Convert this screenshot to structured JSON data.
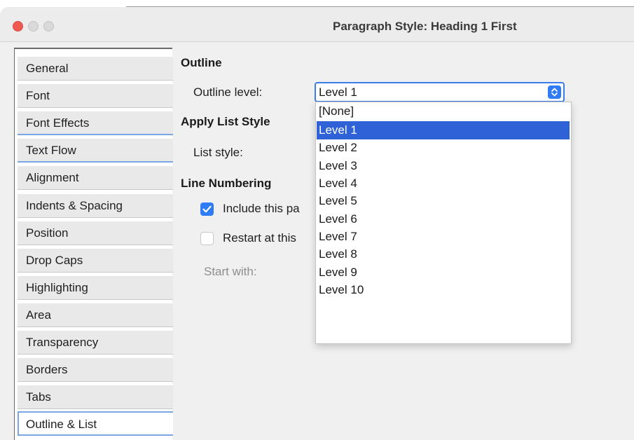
{
  "window": {
    "title": "Paragraph Style: Heading 1 First"
  },
  "sidebar": {
    "tabs": [
      {
        "label": "General"
      },
      {
        "label": "Font"
      },
      {
        "label": "Font Effects"
      },
      {
        "label": "Text Flow"
      },
      {
        "label": "Alignment"
      },
      {
        "label": "Indents & Spacing"
      },
      {
        "label": "Position"
      },
      {
        "label": "Drop Caps"
      },
      {
        "label": "Highlighting"
      },
      {
        "label": "Area"
      },
      {
        "label": "Transparency"
      },
      {
        "label": "Borders"
      },
      {
        "label": "Tabs"
      },
      {
        "label": "Outline & List"
      }
    ],
    "selected": "Outline & List"
  },
  "outline": {
    "heading": "Outline",
    "level_label": "Outline level:",
    "level_value": "Level 1"
  },
  "list_style": {
    "heading": "Apply List Style",
    "label": "List style:"
  },
  "line_numbering": {
    "heading": "Line Numbering",
    "include_label": "Include this pa",
    "include_checked": true,
    "restart_label": "Restart at this",
    "restart_checked": false,
    "start_label": "Start with:"
  },
  "dropdown": {
    "options": [
      {
        "label": "[None]"
      },
      {
        "label": "Level 1"
      },
      {
        "label": "Level 2"
      },
      {
        "label": "Level 3"
      },
      {
        "label": "Level 4"
      },
      {
        "label": "Level 5"
      },
      {
        "label": "Level 6"
      },
      {
        "label": "Level 7"
      },
      {
        "label": "Level 8"
      },
      {
        "label": "Level 9"
      },
      {
        "label": "Level 10"
      }
    ],
    "selected": "Level 1"
  },
  "colors": {
    "accent": "#2f7cf6",
    "selection": "#2f62d6",
    "tab_accent": "#7aa6e6",
    "close_button": "#ee5a52"
  }
}
